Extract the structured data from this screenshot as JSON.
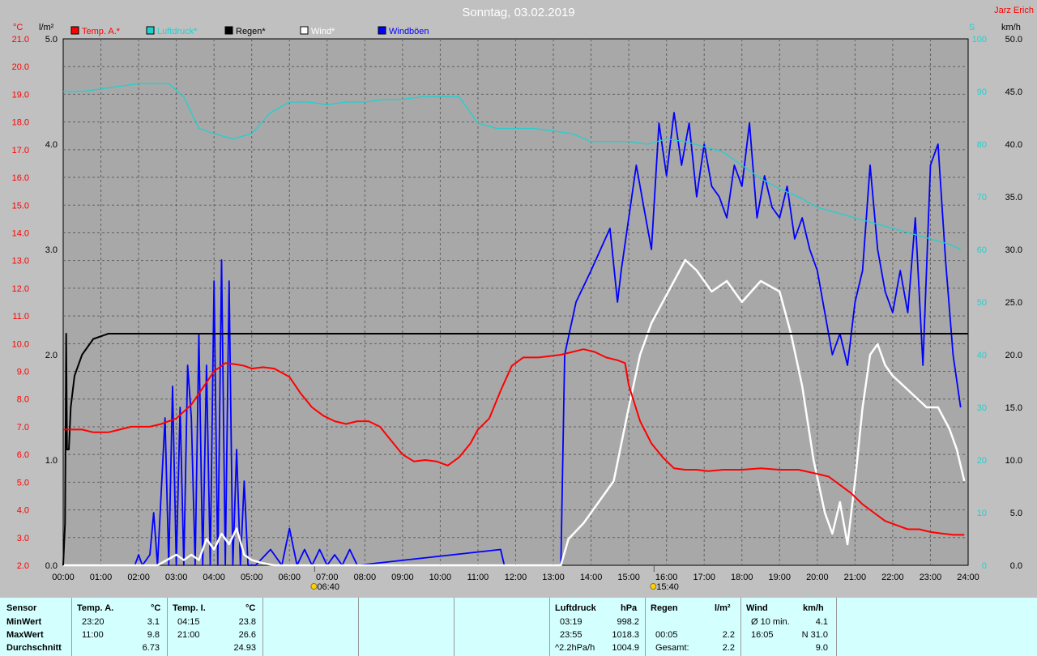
{
  "colors": {
    "temp": "#ff0000",
    "pressure": "#20d0d0",
    "rain": "#000000",
    "wind": "#ffffff",
    "gusts": "#0000ff",
    "plot_bg": "#a8a8a8",
    "stats_bg": "#d4ffff"
  },
  "chart_data": {
    "type": "line",
    "title": "Sonntag, 03.02.2019",
    "author": "Jarz Erich",
    "axis_units": {
      "temp": "°C",
      "rain": "l/m²",
      "pressure": "S",
      "wind": "km/h"
    },
    "legend": [
      "Temp. A.*",
      "Luftdruck*",
      "Regen*",
      "Wind*",
      "Windböen"
    ],
    "legend_placement": "top",
    "grid": true,
    "x_label": "",
    "x_range": [
      0,
      24
    ],
    "x_ticks": [
      "00:00",
      "01:00",
      "02:00",
      "03:00",
      "04:00",
      "05:00",
      "06:00",
      "07:00",
      "08:00",
      "09:00",
      "10:00",
      "11:00",
      "12:00",
      "13:00",
      "14:00",
      "15:00",
      "16:00",
      "17:00",
      "18:00",
      "19:00",
      "20:00",
      "21:00",
      "22:00",
      "23:00",
      "24:00"
    ],
    "sun_markers": [
      {
        "x": 6.67,
        "label": "06:40"
      },
      {
        "x": 15.67,
        "label": "15:40"
      }
    ],
    "temp_axis": {
      "min": 2.0,
      "max": 21.0,
      "ticks": [
        "2.0",
        "3.0",
        "4.0",
        "5.0",
        "6.0",
        "7.0",
        "8.0",
        "9.0",
        "10.0",
        "11.0",
        "12.0",
        "13.0",
        "14.0",
        "15.0",
        "16.0",
        "17.0",
        "18.0",
        "19.0",
        "20.0",
        "21.0"
      ]
    },
    "rain_axis": {
      "min": 0,
      "max": 5,
      "ticks": [
        "0.0",
        "1.0",
        "2.0",
        "3.0",
        "4.0",
        "5.0"
      ]
    },
    "pressure_axis": {
      "min": 0,
      "max": 100,
      "ticks": [
        "0",
        "10",
        "20",
        "30",
        "40",
        "50",
        "60",
        "70",
        "80",
        "90",
        "100"
      ]
    },
    "wind_axis": {
      "min": 0,
      "max": 50,
      "ticks": [
        "0.0",
        "5.0",
        "10.0",
        "15.0",
        "20.0",
        "25.0",
        "30.0",
        "35.0",
        "40.0",
        "45.0",
        "50.0"
      ]
    },
    "series": [
      {
        "name": "Temp. A.*",
        "axis": "temp",
        "x": [
          0,
          0.5,
          0.8,
          1.2,
          1.5,
          1.8,
          2.0,
          2.3,
          2.6,
          3.0,
          3.4,
          3.7,
          4.0,
          4.3,
          4.6,
          4.8,
          5.0,
          5.3,
          5.6,
          6.0,
          6.3,
          6.6,
          6.9,
          7.2,
          7.5,
          7.8,
          8.1,
          8.4,
          8.7,
          9.0,
          9.3,
          9.6,
          9.9,
          10.2,
          10.5,
          10.8,
          11.0,
          11.3,
          11.6,
          11.9,
          12.2,
          12.6,
          12.9,
          13.2,
          13.5,
          13.8,
          14.1,
          14.4,
          14.7,
          14.9,
          15.0,
          15.3,
          15.6,
          15.9,
          16.2,
          16.5,
          16.8,
          17.1,
          17.5,
          18.0,
          18.5,
          19.0,
          19.5,
          20.0,
          20.3,
          20.6,
          20.9,
          21.2,
          21.5,
          21.8,
          22.1,
          22.4,
          22.7,
          23.0,
          23.3,
          23.6,
          23.9
        ],
        "y": [
          6.9,
          6.9,
          6.8,
          6.8,
          6.9,
          7.0,
          7.0,
          7.0,
          7.1,
          7.3,
          7.8,
          8.4,
          9.0,
          9.3,
          9.25,
          9.2,
          9.1,
          9.15,
          9.1,
          8.8,
          8.2,
          7.7,
          7.4,
          7.2,
          7.1,
          7.2,
          7.2,
          7.0,
          6.5,
          6.0,
          5.75,
          5.8,
          5.75,
          5.6,
          5.9,
          6.4,
          6.9,
          7.3,
          8.3,
          9.2,
          9.5,
          9.5,
          9.55,
          9.6,
          9.7,
          9.8,
          9.7,
          9.5,
          9.4,
          9.3,
          8.5,
          7.2,
          6.4,
          5.9,
          5.5,
          5.45,
          5.45,
          5.4,
          5.45,
          5.45,
          5.5,
          5.45,
          5.45,
          5.3,
          5.2,
          4.9,
          4.6,
          4.2,
          3.9,
          3.6,
          3.45,
          3.3,
          3.3,
          3.2,
          3.15,
          3.1,
          3.1
        ]
      },
      {
        "name": "Luftdruck*",
        "axis": "pressure",
        "x": [
          0,
          0.5,
          1.0,
          1.5,
          2.0,
          2.5,
          2.8,
          3.2,
          3.6,
          4.0,
          4.5,
          5.0,
          5.5,
          6.0,
          6.5,
          7.0,
          7.5,
          8.0,
          8.5,
          9.0,
          9.5,
          10.0,
          10.5,
          11.0,
          11.5,
          12.0,
          12.5,
          13.0,
          13.5,
          14.0,
          14.5,
          15.0,
          15.5,
          16.0,
          16.5,
          17.0,
          17.5,
          18.0,
          18.5,
          19.0,
          19.5,
          20.0,
          20.5,
          21.0,
          21.5,
          22.0,
          22.5,
          23.0,
          23.5,
          23.8
        ],
        "y": [
          90,
          90,
          90.5,
          91,
          91.5,
          91.5,
          91.5,
          89,
          83,
          82,
          81,
          82,
          86,
          88,
          88,
          87.5,
          88,
          88,
          88.5,
          88.5,
          89,
          89,
          89,
          84,
          83,
          83,
          83,
          82.5,
          82,
          80.5,
          80.5,
          80.5,
          80,
          81,
          80.5,
          79.5,
          78.5,
          76,
          73.5,
          71.5,
          70,
          68,
          67,
          66,
          65,
          64,
          63,
          62,
          61,
          60
        ]
      },
      {
        "name": "Regen*",
        "axis": "rain",
        "x": [
          0,
          0.05,
          0.08,
          0.1,
          0.15,
          0.2,
          0.3,
          0.5,
          0.8,
          1.2,
          1.6,
          2.0,
          24
        ],
        "y": [
          0,
          0.4,
          2.2,
          1.1,
          1.1,
          1.5,
          1.8,
          2.0,
          2.15,
          2.2,
          2.2,
          2.2,
          2.2
        ]
      },
      {
        "name": "Wind*",
        "axis": "wind",
        "x": [
          0,
          2.5,
          3.0,
          3.2,
          3.4,
          3.6,
          3.8,
          4.0,
          4.2,
          4.4,
          4.6,
          4.8,
          5.0,
          5.3,
          5.6,
          13.2,
          13.4,
          13.8,
          14.2,
          14.6,
          15.0,
          15.3,
          15.6,
          15.9,
          16.2,
          16.5,
          16.8,
          17.2,
          17.6,
          18.0,
          18.5,
          19.0,
          19.3,
          19.6,
          19.9,
          20.2,
          20.4,
          20.6,
          20.8,
          21.0,
          21.2,
          21.4,
          21.6,
          21.8,
          22.0,
          22.3,
          22.6,
          22.9,
          23.2,
          23.5,
          23.7,
          23.9
        ],
        "y": [
          0,
          0,
          1,
          0.5,
          1,
          0.5,
          2.5,
          1.5,
          3,
          2,
          3.5,
          1,
          0.5,
          0.2,
          0,
          0,
          2.5,
          4,
          6,
          8,
          15,
          20,
          23,
          25,
          27,
          29,
          28,
          26,
          27,
          25,
          27,
          26,
          22,
          17,
          10,
          5,
          3,
          6,
          2,
          8,
          15,
          20,
          21,
          19,
          18,
          17,
          16,
          15,
          15,
          13,
          11,
          8
        ]
      },
      {
        "name": "Windböen",
        "axis": "wind",
        "x": [
          0,
          1.9,
          2.0,
          2.1,
          2.3,
          2.4,
          2.5,
          2.7,
          2.8,
          2.9,
          3.0,
          3.1,
          3.2,
          3.3,
          3.4,
          3.5,
          3.6,
          3.7,
          3.8,
          3.9,
          4.0,
          4.1,
          4.2,
          4.3,
          4.4,
          4.5,
          4.6,
          4.7,
          4.8,
          4.9,
          5.0,
          5.1,
          5.5,
          5.8,
          6.0,
          6.2,
          6.4,
          6.6,
          6.8,
          7.0,
          7.2,
          7.4,
          7.6,
          7.8,
          11.6,
          11.7,
          11.8,
          13.2,
          13.3,
          13.6,
          14.0,
          14.5,
          14.7,
          14.8,
          15.0,
          15.2,
          15.4,
          15.6,
          15.8,
          16.0,
          16.2,
          16.4,
          16.6,
          16.8,
          17.0,
          17.2,
          17.4,
          17.6,
          17.8,
          18.0,
          18.2,
          18.4,
          18.6,
          18.8,
          19.0,
          19.2,
          19.4,
          19.6,
          19.8,
          20.0,
          20.2,
          20.4,
          20.6,
          20.8,
          21.0,
          21.2,
          21.4,
          21.6,
          21.8,
          22.0,
          22.2,
          22.4,
          22.6,
          22.8,
          23.0,
          23.2,
          23.4,
          23.6,
          23.8
        ],
        "y": [
          0,
          0,
          1,
          0,
          1,
          5,
          0,
          14,
          0,
          17,
          0,
          15,
          0,
          19,
          14,
          0,
          22,
          0,
          19,
          0,
          27,
          0,
          29,
          0,
          27,
          0,
          11,
          0,
          8,
          0,
          0,
          0,
          1.5,
          0,
          3.5,
          0,
          1.5,
          0,
          1.5,
          0,
          1,
          0,
          1.5,
          0,
          1.5,
          0,
          0,
          0,
          20,
          25,
          28,
          32,
          25,
          28,
          33,
          38,
          34,
          30,
          42,
          37,
          43,
          38,
          42,
          35,
          40,
          36,
          35,
          33,
          38,
          36,
          42,
          33,
          37,
          34,
          33,
          36,
          31,
          33,
          30,
          28,
          24,
          20,
          22,
          19,
          25,
          28,
          38,
          30,
          26,
          24,
          28,
          24,
          33,
          19,
          38,
          40,
          29,
          20,
          15
        ],
        "note_visible_values": []
      }
    ]
  },
  "stats": {
    "sensor_header": "Sensor",
    "rows": [
      "MinWert",
      "MaxWert",
      "Durchschnitt"
    ],
    "temp_a": {
      "header": "Temp. A.",
      "unit": "°C",
      "min_time": "23:20",
      "min": "3.1",
      "max_time": "11:00",
      "max": "9.8",
      "avg": "6.73"
    },
    "temp_i": {
      "header": "Temp. I.",
      "unit": "°C",
      "min_time": "04:15",
      "min": "23.8",
      "max_time": "21:00",
      "max": "26.6",
      "avg": "24.93"
    },
    "pressure": {
      "header": "Luftdruck",
      "unit": "hPa",
      "min_time": "03:19",
      "min": "998.2",
      "max_time": "23:55",
      "max": "1018.3",
      "trend_label": "^2.2hPa/h",
      "trend_value": "1004.9"
    },
    "rain": {
      "header": "Regen",
      "unit": "l/m²",
      "max_time": "00:05",
      "max": "2.2",
      "total_label": "Gesamt:",
      "total": "2.2"
    },
    "wind": {
      "header": "Wind",
      "unit": "km/h",
      "avg_label": "Ø 10 min.",
      "avg": "4.1",
      "max_time": "16:05",
      "max": "N 31.0",
      "value3": "9.0"
    }
  }
}
